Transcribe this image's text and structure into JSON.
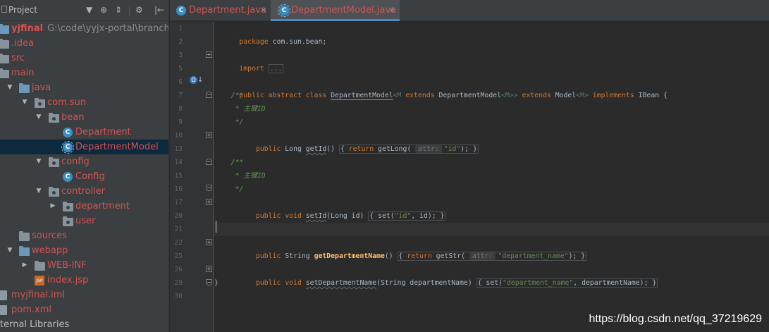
{
  "project_panel": {
    "title": "Project",
    "toolbar": [
      "▼",
      "⊕",
      "⇕",
      "⚙",
      "|←"
    ],
    "tree": [
      {
        "label": "yjfinal",
        "path": "G:\\code\\yyjx-portal\\branches\\myj",
        "depth": 0,
        "arrow": "",
        "icon": "folder-blue",
        "style": "bold"
      },
      {
        "label": ".idea",
        "depth": 0,
        "arrow": "",
        "icon": "folder",
        "style": "red"
      },
      {
        "label": "src",
        "depth": 0,
        "arrow": "",
        "icon": "folder",
        "style": "red"
      },
      {
        "label": "main",
        "depth": 0,
        "arrow": "",
        "icon": "folder",
        "style": "red"
      },
      {
        "label": "java",
        "depth": 1,
        "arrow": "▼",
        "icon": "folder-blue",
        "style": "red"
      },
      {
        "label": "com.sun",
        "depth": 2,
        "arrow": "▼",
        "icon": "package",
        "style": "red"
      },
      {
        "label": "bean",
        "depth": 3,
        "arrow": "▼",
        "icon": "package",
        "style": "red"
      },
      {
        "label": "Department",
        "depth": 4,
        "arrow": "",
        "icon": "class",
        "style": "red"
      },
      {
        "label": "DepartmentModel",
        "depth": 4,
        "arrow": "",
        "icon": "abstract-class",
        "style": "red",
        "selected": true
      },
      {
        "label": "config",
        "depth": 3,
        "arrow": "▼",
        "icon": "package",
        "style": "red"
      },
      {
        "label": "Config",
        "depth": 4,
        "arrow": "",
        "icon": "class",
        "style": "red"
      },
      {
        "label": "controller",
        "depth": 3,
        "arrow": "▼",
        "icon": "package",
        "style": "red"
      },
      {
        "label": "department",
        "depth": 4,
        "arrow": "▶",
        "icon": "package",
        "style": "red"
      },
      {
        "label": "user",
        "depth": 4,
        "arrow": "",
        "icon": "package",
        "style": "red"
      },
      {
        "label": "sources",
        "depth": 1,
        "arrow": "",
        "icon": "folder",
        "style": "red"
      },
      {
        "label": "webapp",
        "depth": 1,
        "arrow": "▼",
        "icon": "folder-blue",
        "style": "red"
      },
      {
        "label": "WEB-INF",
        "depth": 2,
        "arrow": "▶",
        "icon": "folder",
        "style": "red"
      },
      {
        "label": "index.jsp",
        "depth": 2,
        "arrow": "",
        "icon": "jsp",
        "style": "red"
      },
      {
        "label": "myjfinal.iml",
        "depth": 0,
        "arrow": "",
        "icon": "file",
        "style": "red"
      },
      {
        "label": "pom.xml",
        "depth": 0,
        "arrow": "",
        "icon": "maven",
        "style": "red"
      },
      {
        "label": "ternal Libraries",
        "depth": 0,
        "arrow": "",
        "icon": "none",
        "style": "plain"
      }
    ]
  },
  "tabs": [
    {
      "label": "Department.java",
      "icon": "C",
      "active": false
    },
    {
      "label": "DepartmentModel.java",
      "icon": "C",
      "active": true
    }
  ],
  "editor": {
    "line_numbers": [
      "1",
      "2",
      "3",
      "5",
      "6",
      "7",
      "8",
      "9",
      "10",
      "13",
      "14",
      "15",
      "16",
      "17",
      "20",
      "21",
      "22",
      "25",
      "26",
      "29",
      "30"
    ],
    "lines": {
      "l1": {
        "kw": "package",
        "rest": " com.sun.bean;"
      },
      "l3": {
        "kw": "import",
        "fold": "..."
      },
      "l6": {
        "kw1": "public abstract class ",
        "cls": "DepartmentModel",
        "g1": "<M ",
        "kw2": "extends",
        "t1": " DepartmentModel",
        "g2": "<M>> ",
        "kw3": "extends",
        "t2": " Model",
        "g3": "<M> ",
        "kw4": "implements",
        "t3": " IBean {"
      },
      "doc_open": "/**",
      "doc_body": "* 主键ID",
      "doc_close": "*/",
      "l10": {
        "kw": "public",
        "t1": " Long ",
        "fn": "getId",
        "t2": "() ",
        "kw2": "return",
        "t3": " getLong(",
        "hint": "attr:",
        "str": "\"id\"",
        "t4": ");"
      },
      "l17": {
        "kw": "public void",
        "fn": "setId",
        "t1": "(Long id) ",
        "t2": "set(",
        "str": "\"id\"",
        "t3": ", id);"
      },
      "l22": {
        "kw": "public",
        "t1": " String ",
        "fn": "getDepartmentName",
        "t2": "() ",
        "kw2": "return",
        "t3": " getStr(",
        "hint": "attr:",
        "str": "\"department_name\"",
        "t4": ");"
      },
      "l26": {
        "kw": "public void",
        "fn": "setDepartmentName",
        "t1": "(String departmentName) ",
        "t2": "set(",
        "str": "\"department_name\"",
        "t3": ", departmentName);"
      },
      "l29": "}"
    }
  },
  "watermark": "https://blog.csdn.net/qq_37219629",
  "colors": {
    "accent": "#4a88c7",
    "modified_file": "#d25252",
    "keyword": "#cc7832",
    "string": "#6a8759",
    "comment": "#629755"
  }
}
